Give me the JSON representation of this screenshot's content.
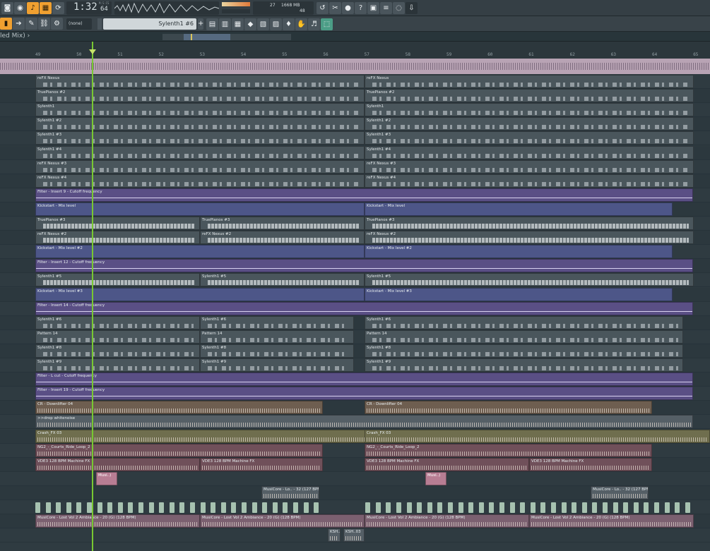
{
  "toolbar": {
    "time_big": "1:32",
    "time_small": "64",
    "time_mode": "M:S:CS",
    "pattern_select": "(none)",
    "instrument_name": "Sylenth1 #6",
    "cpu_value": "27",
    "mem_value": "1668 MB",
    "poly_value": "48",
    "buttons": [
      "undo",
      "snap",
      "cut",
      "link",
      "glue",
      "record"
    ]
  },
  "title_bar": {
    "text": "led Mix) ›"
  },
  "ruler": {
    "bars": [
      "49",
      "50",
      "51",
      "52",
      "53",
      "54",
      "55",
      "56",
      "57",
      "58",
      "59",
      "60",
      "61",
      "62",
      "63",
      "64",
      "65"
    ]
  },
  "tracks": [
    {
      "clips": [
        {
          "label": "reFX Nexus"
        },
        {
          "label": "reFX Nexus"
        }
      ]
    },
    {
      "clips": [
        {
          "label": "TruePianos #2"
        },
        {
          "label": "TruePianos #2"
        }
      ]
    },
    {
      "clips": [
        {
          "label": "Sylenth1"
        },
        {
          "label": "Sylenth1"
        }
      ]
    },
    {
      "clips": [
        {
          "label": "Sylenth1 #2"
        },
        {
          "label": "Sylenth1 #2"
        }
      ]
    },
    {
      "clips": [
        {
          "label": "Sylenth1 #3"
        },
        {
          "label": "Sylenth1 #3"
        }
      ]
    },
    {
      "clips": [
        {
          "label": "Sylenth1 #4"
        },
        {
          "label": "Sylenth1 #4"
        }
      ]
    },
    {
      "clips": [
        {
          "label": "reFX Nexus #3"
        },
        {
          "label": "reFX Nexus #3"
        }
      ]
    },
    {
      "clips": [
        {
          "label": "reFX Nexus #4"
        },
        {
          "label": "reFX Nexus #4"
        }
      ]
    },
    {
      "clips": [
        {
          "label": "Filter - Insert 9 - Cutoff frequency"
        }
      ]
    },
    {
      "clips": [
        {
          "label": "Kickstart - Mix level"
        },
        {
          "label": "Kickstart - Mix level"
        }
      ]
    },
    {
      "clips": [
        {
          "label": "TruePianos #3"
        },
        {
          "label": "TruePianos #3"
        },
        {
          "label": "TruePianos #3"
        }
      ]
    },
    {
      "clips": [
        {
          "label": "reFX Nexus #2"
        },
        {
          "label": "reFX Nexus #2"
        },
        {
          "label": "reFX Nexus #2"
        }
      ]
    },
    {
      "clips": [
        {
          "label": "Kickstart - Mix level #2"
        },
        {
          "label": "Kickstart - Mix level #2"
        }
      ]
    },
    {
      "clips": [
        {
          "label": "Filter - Insert 12 - Cutoff frequency"
        }
      ]
    },
    {
      "clips": [
        {
          "label": "Sylenth1 #5"
        },
        {
          "label": "Sylenth1 #5"
        },
        {
          "label": "Sylenth1 #5"
        }
      ]
    },
    {
      "clips": [
        {
          "label": "Kickstart - Mix level #3"
        },
        {
          "label": "Kickstart - Mix level #3"
        }
      ]
    },
    {
      "clips": [
        {
          "label": "Filter - Insert 14 - Cutoff frequency"
        }
      ]
    },
    {
      "clips": [
        {
          "label": "Sylenth1 #6"
        },
        {
          "label": "Sylenth1 #6"
        },
        {
          "label": "Sylenth1 #6"
        }
      ]
    },
    {
      "clips": [
        {
          "label": "Pattern 14"
        },
        {
          "label": "Pattern 14"
        },
        {
          "label": "Pattern 14"
        }
      ]
    },
    {
      "clips": [
        {
          "label": "Sylenth1 #8"
        },
        {
          "label": "Sylenth1 #8"
        },
        {
          "label": "Sylenth1 #8"
        }
      ]
    },
    {
      "clips": [
        {
          "label": "Sylenth1 #9"
        },
        {
          "label": "Sylenth1 #9"
        },
        {
          "label": "Sylenth1 #9"
        }
      ]
    },
    {
      "clips": [
        {
          "label": "Filter - L cut - Cutoff frequency"
        }
      ]
    },
    {
      "clips": [
        {
          "label": "Filter - Insert 19 - Cutoff frequency"
        }
      ]
    },
    {
      "clips": [
        {
          "label": "CR - Downlifter 04"
        },
        {
          "label": "CR - Downlifter 04"
        }
      ]
    },
    {
      "clips": [
        {
          "label": ">>drop whitenoise"
        }
      ]
    },
    {
      "clips": [
        {
          "label": "Crash_FX 03"
        },
        {
          "label": "Crash_FX 03"
        }
      ]
    },
    {
      "clips": [
        {
          "label": "NG2_-_Courts_Ride_Loop_2"
        },
        {
          "label": "NG2_-_Courts_Ride_Loop_2"
        }
      ]
    },
    {
      "clips": [
        {
          "label": "VDE3 128 BPM Machine FX"
        },
        {
          "label": "VDE3 128 BPM Machine FX"
        },
        {
          "label": "VDE3 128 BPM Machine FX"
        },
        {
          "label": "VDE3 128 BPM Machine FX"
        }
      ]
    },
    {
      "clips": [
        {
          "label": "Musi..)"
        },
        {
          "label": "Musi..)"
        }
      ]
    },
    {
      "clips": [
        {
          "label": "MusiCore - Lo.. - 32 (127 BPM)"
        },
        {
          "label": "MusiCore - Lo.. - 32 (127 BPM)"
        }
      ]
    },
    {
      "clips": []
    },
    {
      "clips": [
        {
          "label": "MusiCore - Lost Vol 2 Ambiance - 20 (G) (128 BPM)"
        },
        {
          "label": "MusiCore - Lost Vol 2 Ambiance - 20 (G) (128 BPM)"
        },
        {
          "label": "MusiCore - Lost Vol 2 Ambiance - 20 (G) (128 BPM)"
        },
        {
          "label": "MusiCore - Lost Vol 2 Ambiance - 20 (G) (128 BPM)"
        }
      ]
    },
    {
      "clips": [
        {
          "label": "KSH..03"
        },
        {
          "label": "KSH..03"
        }
      ]
    }
  ]
}
